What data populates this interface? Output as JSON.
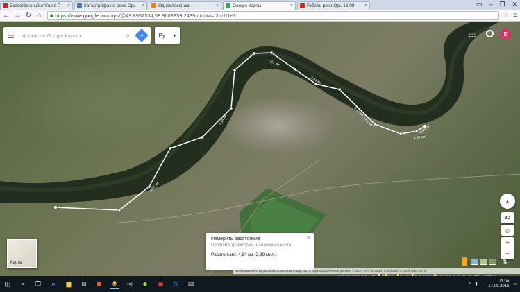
{
  "browser": {
    "tabs": [
      {
        "label": "Естественный отбор в Р",
        "favicon_color": "#cc2222",
        "active": false
      },
      {
        "label": "Катастрофа на реке Орь",
        "favicon_color": "#4a76a8",
        "active": false
      },
      {
        "label": "Одноклассники",
        "favicon_color": "#ee8208",
        "active": false
      },
      {
        "label": "Google Карты",
        "favicon_color": "#34a853",
        "active": true
      },
      {
        "label": "Гибель реки Орь 16 08",
        "favicon_color": "#e62117",
        "active": false
      }
    ],
    "url_scheme": "https://",
    "url_host": "www.google.ru",
    "url_path": "/maps/@49.8952534,58.9603959,2439m/data=!3m1!1e3"
  },
  "search": {
    "placeholder": "Искать на Google Картах",
    "language": "Ру"
  },
  "measure_card": {
    "title": "Измерить расстояние",
    "hint": "Продлите траекторию, нажимая на карте",
    "distance": "Расстояние: 4,64 км (2,89 мил.)"
  },
  "layer_toggle": {
    "label": "Карта"
  },
  "controls": {
    "tilt_label": "3D",
    "zoom_in": "+",
    "zoom_out": "−"
  },
  "map_labels": [
    "0,57 км",
    "1,15 км",
    "1,91 км",
    "2,44 км",
    "3,32 км",
    "3,64 км",
    "4,32 км",
    "4,64 км"
  ],
  "footer": "Изображения © DigitalGlobe,Cnes/Spot Image, 2016,Картографические данные © 2016   Усл. использ.   Сообщить о проблеме   200 м",
  "watermark": "www.aktobehunter.ucoz.ru",
  "clock": {
    "time": "17:08",
    "date": "17.08.2016"
  },
  "avatar_letter": "E"
}
